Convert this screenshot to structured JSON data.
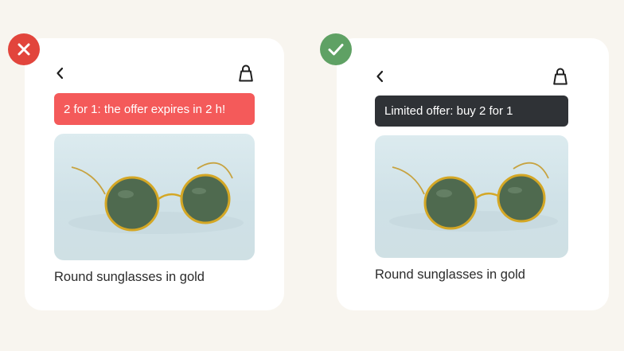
{
  "bad_example": {
    "verdict_icon": "cross-icon",
    "verdict_color": "#e2453c",
    "banner_text": "2 for 1: the offer expires in 2 h!",
    "banner_color": "#f45a5a",
    "product_title": "Round sunglasses in gold",
    "nav_back_icon": "chevron-left-icon",
    "nav_bag_icon": "shopping-bag-icon"
  },
  "good_example": {
    "verdict_icon": "check-icon",
    "verdict_color": "#5fa164",
    "banner_text": "Limited offer: buy 2 for 1",
    "banner_color": "#2f3236",
    "product_title": "Round sunglasses in gold",
    "nav_back_icon": "chevron-left-icon",
    "nav_bag_icon": "shopping-bag-icon"
  }
}
